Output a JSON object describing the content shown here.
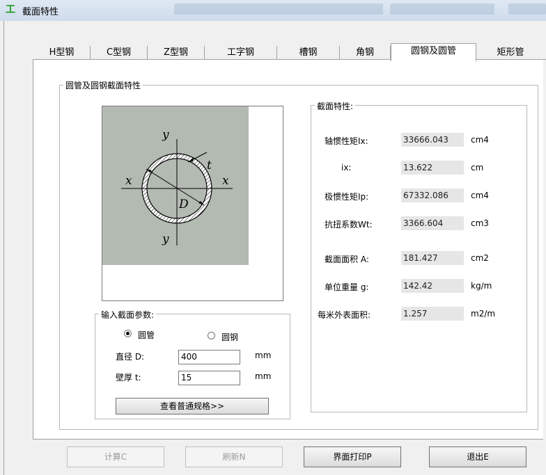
{
  "window": {
    "title": "截面特性",
    "app_icon": "I-beam-icon"
  },
  "tabs": [
    {
      "label": "H型钢"
    },
    {
      "label": "C型钢"
    },
    {
      "label": "Z型钢"
    },
    {
      "label": "工字钢"
    },
    {
      "label": "槽钢"
    },
    {
      "label": "角钢"
    },
    {
      "label": "圆钢及圆管",
      "active": true
    },
    {
      "label": "矩形管"
    }
  ],
  "main_group": {
    "title": "圆管及圆钢截面特性"
  },
  "diagram": {
    "y_top": "y",
    "y_bottom": "y",
    "x_left": "x",
    "x_right": "x",
    "t": "t",
    "D": "D",
    "fill": "#b3bab2"
  },
  "input_group": {
    "title": "输入截面参数:",
    "radio_pipe": "圆管",
    "radio_rod": "圆钢",
    "selected": "圆管",
    "diameter": {
      "label": "直径 D:",
      "value": "400",
      "unit": "mm"
    },
    "thickness": {
      "label": "壁厚 t:",
      "value": "15",
      "unit": "mm"
    },
    "spec_button": "查看普通规格>>"
  },
  "props_group": {
    "title": "截面特性:",
    "rows": [
      {
        "label": "轴惯性矩Ix:",
        "value": "33666.043",
        "unit": "cm4"
      },
      {
        "label": "ix:",
        "value": "13.622",
        "unit": "cm"
      },
      {
        "label": "极惯性矩Ip:",
        "value": "67332.086",
        "unit": "cm4"
      },
      {
        "label": "抗扭系数Wt:",
        "value": "3366.604",
        "unit": "cm3"
      },
      {
        "label": "截面面积 A:",
        "value": "181.427",
        "unit": "cm2"
      },
      {
        "label": "单位重量 g:",
        "value": "142.42",
        "unit": "kg/m"
      },
      {
        "label": "每米外表面积:",
        "value": "1.257",
        "unit": "m2/m"
      }
    ]
  },
  "buttons": {
    "calc": "计算C",
    "refresh": "刷新N",
    "print": "界面打印P",
    "exit": "退出E"
  }
}
